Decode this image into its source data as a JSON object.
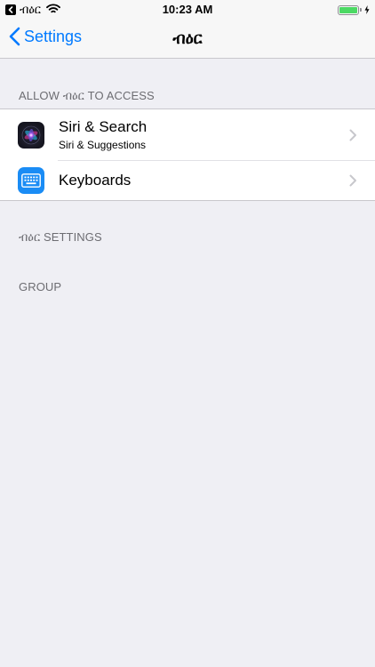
{
  "status_bar": {
    "app_name": "ብዕር",
    "time": "10:23 AM",
    "battery_percent": 100
  },
  "nav": {
    "back_label": "Settings",
    "title": "ብዕር"
  },
  "sections": {
    "allow_access_header": "ALLOW ብዕር TO ACCESS",
    "app_settings_header": "ብዕር SETTINGS",
    "group_header": "GROUP"
  },
  "rows": {
    "siri": {
      "title": "Siri & Search",
      "subtitle": "Siri & Suggestions",
      "icon": "siri-icon"
    },
    "keyboards": {
      "title": "Keyboards",
      "icon": "keyboard-icon"
    }
  },
  "colors": {
    "accent": "#007aff",
    "background": "#efeff4",
    "battery": "#4cd964",
    "keyboard_icon": "#1a8cf5"
  }
}
